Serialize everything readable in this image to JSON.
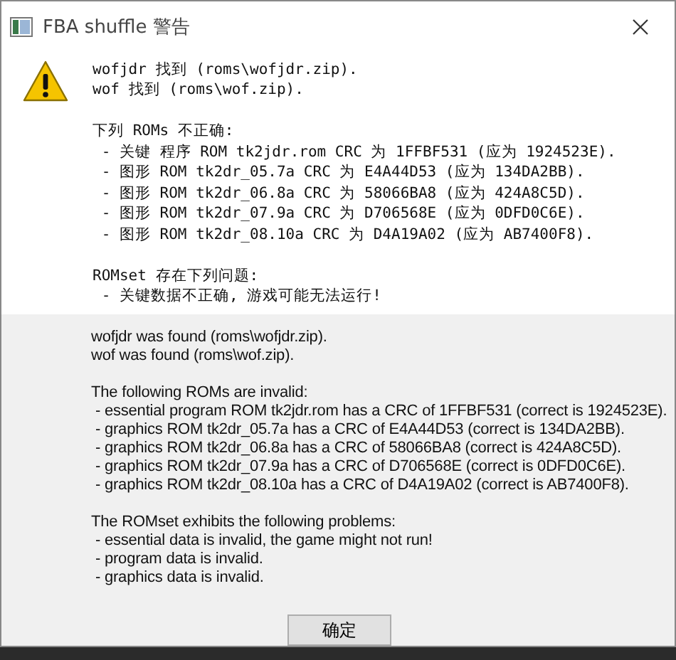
{
  "window": {
    "title": "FBA shuffle 警告"
  },
  "chinese_message": [
    [
      "wofjdr 找到 (roms\\wofjdr.zip).",
      "wof 找到 (roms\\wof.zip)."
    ],
    [
      "下列 ROMs 不正确:",
      " - 关键 程序 ROM tk2jdr.rom CRC 为 1FFBF531 (应为 1924523E).",
      " - 图形 ROM tk2dr_05.7a CRC 为 E4A44D53 (应为 134DA2BB).",
      " - 图形 ROM tk2dr_06.8a CRC 为 58066BA8 (应为 424A8C5D).",
      " - 图形 ROM tk2dr_07.9a CRC 为 D706568E (应为 0DFD0C6E).",
      " - 图形 ROM tk2dr_08.10a CRC 为 D4A19A02 (应为 AB7400F8)."
    ],
    [
      "ROMset 存在下列问题:",
      " - 关键数据不正确, 游戏可能无法运行!"
    ]
  ],
  "english_message": [
    [
      "wofjdr was found (roms\\wofjdr.zip).",
      "wof was found (roms\\wof.zip)."
    ],
    [
      "The following ROMs are invalid:",
      " - essential program ROM tk2jdr.rom has a CRC of 1FFBF531 (correct is 1924523E).",
      " - graphics ROM tk2dr_05.7a has a CRC of E4A44D53 (correct is 134DA2BB).",
      " - graphics ROM tk2dr_06.8a has a CRC of 58066BA8 (correct is 424A8C5D).",
      " - graphics ROM tk2dr_07.9a has a CRC of D706568E (correct is 0DFD0C6E).",
      " - graphics ROM tk2dr_08.10a has a CRC of D4A19A02 (correct is AB7400F8)."
    ],
    [
      "The ROMset exhibits the following problems:",
      " - essential data is invalid, the game might not run!",
      " - program data is invalid.",
      " - graphics data is invalid."
    ]
  ],
  "buttons": [
    "确定"
  ]
}
